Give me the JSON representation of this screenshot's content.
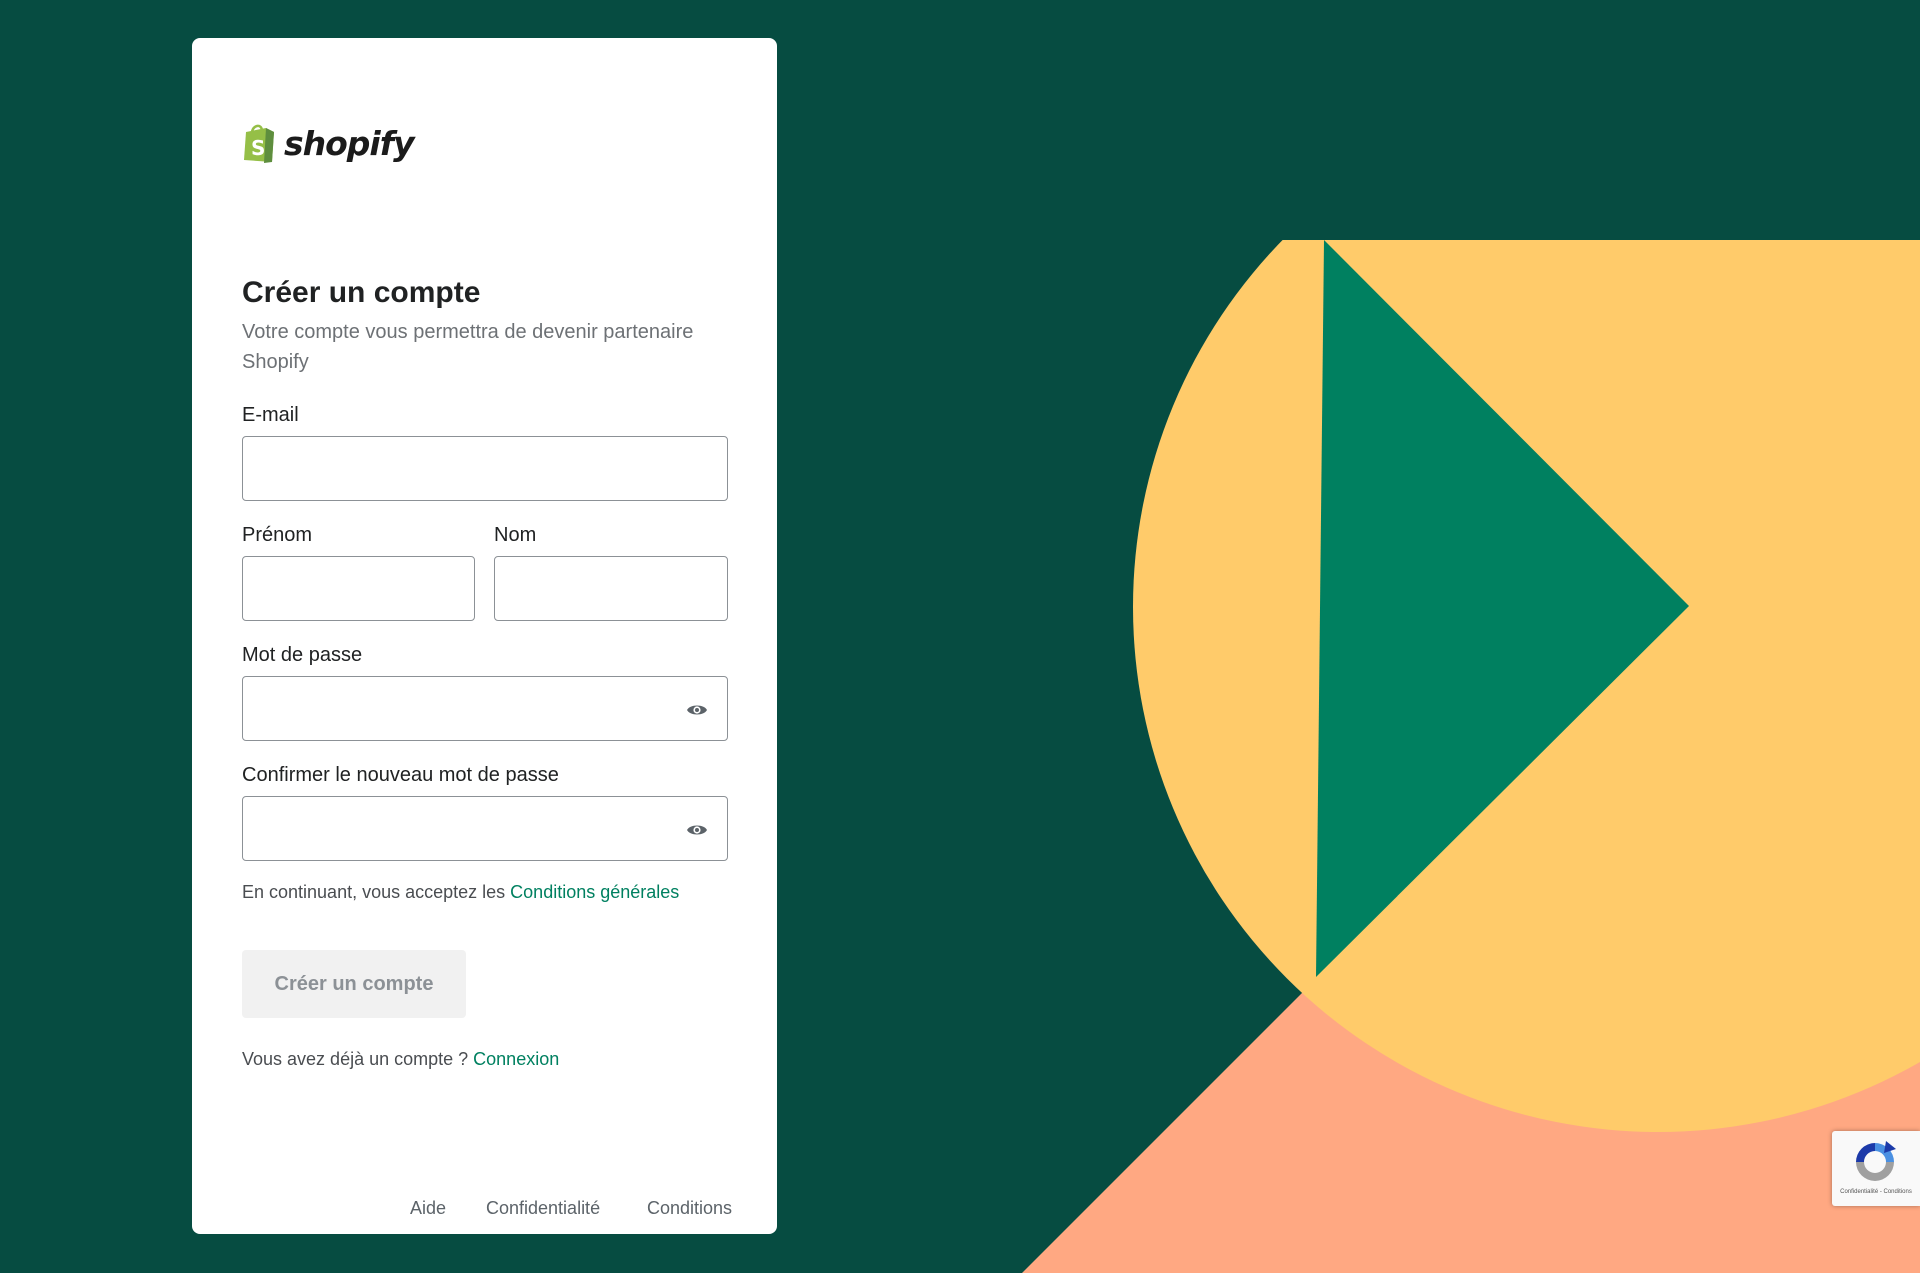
{
  "brand": {
    "name": "shopify",
    "logo_color": "#95BF47",
    "accent": "#008060"
  },
  "form": {
    "title": "Créer un compte",
    "subtitle": "Votre compte vous permettra de devenir partenaire Shopify",
    "email_label": "E-mail",
    "email_value": "",
    "first_name_label": "Prénom",
    "first_name_value": "",
    "last_name_label": "Nom",
    "last_name_value": "",
    "password_label": "Mot de passe",
    "password_value": "",
    "confirm_password_label": "Confirmer le nouveau mot de passe",
    "confirm_password_value": "",
    "show_password_icon": "eye-icon",
    "terms_text": "En continuant, vous acceptez les ",
    "terms_link": "Conditions générales",
    "submit_label": "Créer un compte",
    "submit_state": "disabled",
    "login_prompt": "Vous avez déjà un compte ? ",
    "login_link": "Connexion"
  },
  "footer": {
    "links": [
      "Aide",
      "Confidentialité",
      "Conditions"
    ]
  },
  "recaptcha": {
    "text": "Confidentialité - Conditions",
    "icon": "recaptcha-icon"
  },
  "colors": {
    "background": "#064C41",
    "shape_green": "#008060",
    "shape_yellow": "#FFCB6A",
    "shape_peach": "#FFA882"
  }
}
